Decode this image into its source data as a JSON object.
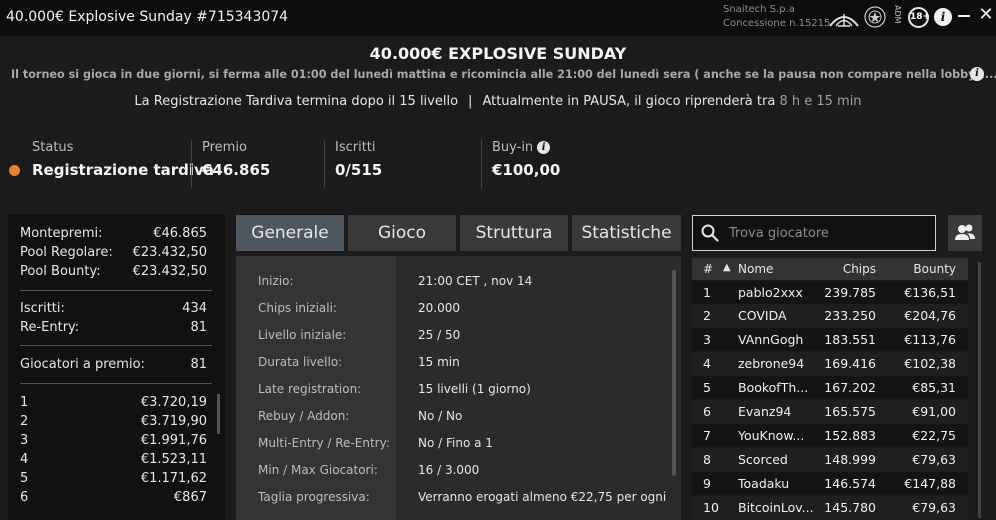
{
  "window": {
    "title": "40.000€ Explosive Sunday #715343074",
    "company_line1": "Snaitech S.p.a",
    "company_line2": "Concessione n.15215",
    "adm_label": "ADM",
    "adm_vertical": "ADM",
    "age_badge": "18+",
    "info_glyph": "i",
    "close_glyph": "✕"
  },
  "header": {
    "title": "40.000€ EXPLOSIVE SUNDAY",
    "description": "Il torneo si gioca in due giorni, si ferma alle 01:00 del lunedì mattina e ricomincia alle 21:00 del lunedì sera ( anche se la pausa non compare nella lobby)....",
    "late_reg": "La Registrazione Tardiva termina dopo il 15 livello",
    "separator": "|",
    "pause_text": "Attualmente in PAUSA, il gioco riprenderà tra",
    "pause_time": "8 h e 15 min"
  },
  "status": {
    "status_label": "Status",
    "status_value": "Registrazione tardiva",
    "status_color": "#e8832a",
    "premio_label": "Premio",
    "premio_value": "€46.865",
    "iscritti_label": "Iscritti",
    "iscritti_value": "0/515",
    "buyin_label": "Buy-in",
    "buyin_value": "€100,00"
  },
  "prize_panel": {
    "montepremi_label": "Montepremi:",
    "montepremi_value": "€46.865",
    "pool_regolare_label": "Pool Regolare:",
    "pool_regolare_value": "€23.432,50",
    "pool_bounty_label": "Pool Bounty:",
    "pool_bounty_value": "€23.432,50",
    "iscritti_label": "Iscritti:",
    "iscritti_value": "434",
    "reentry_label": "Re-Entry:",
    "reentry_value": "81",
    "giocatori_label": "Giocatori a premio:",
    "giocatori_value": "81",
    "payouts": [
      {
        "pos": "1",
        "amount": "€3.720,19"
      },
      {
        "pos": "2",
        "amount": "€3.719,90"
      },
      {
        "pos": "3",
        "amount": "€1.991,76"
      },
      {
        "pos": "4",
        "amount": "€1.523,11"
      },
      {
        "pos": "5",
        "amount": "€1.171,62"
      },
      {
        "pos": "6",
        "amount": "€867"
      }
    ]
  },
  "tabs": [
    {
      "label": "Generale",
      "active": true
    },
    {
      "label": "Gioco",
      "active": false
    },
    {
      "label": "Struttura",
      "active": false
    },
    {
      "label": "Statistiche",
      "active": false
    }
  ],
  "general_info": [
    {
      "key": "Inizio:",
      "value": "21:00 CET , nov 14"
    },
    {
      "key": "Chips iniziali:",
      "value": "20.000"
    },
    {
      "key": "Livello iniziale:",
      "value": "25 / 50"
    },
    {
      "key": "Durata livello:",
      "value": "15 min"
    },
    {
      "key": "Late registration:",
      "value": "15 livelli (1 giorno)"
    },
    {
      "key": "Rebuy / Addon:",
      "value": "No / No"
    },
    {
      "key": "Multi-Entry / Re-Entry:",
      "value": "No / Fino a 1"
    },
    {
      "key": "Min / Max Giocatori:",
      "value": "16 / 3.000"
    },
    {
      "key": "Taglia progressiva:",
      "value": "Verranno erogati almeno €22,75 per ogni"
    }
  ],
  "search": {
    "placeholder": "Trova giocatore"
  },
  "players": {
    "headers": {
      "num": "#",
      "sort": "▲",
      "name": "Nome",
      "chips": "Chips",
      "bounty": "Bounty"
    },
    "rows": [
      {
        "num": "1",
        "name": "pablo2xxx",
        "chips": "239.785",
        "bounty": "€136,51"
      },
      {
        "num": "2",
        "name": "COVIDA",
        "chips": "233.250",
        "bounty": "€204,76"
      },
      {
        "num": "3",
        "name": "VAnnGogh",
        "chips": "183.551",
        "bounty": "€113,76"
      },
      {
        "num": "4",
        "name": "zebrone94",
        "chips": "169.416",
        "bounty": "€102,38"
      },
      {
        "num": "5",
        "name": "BookofTh...",
        "chips": "167.202",
        "bounty": "€85,31"
      },
      {
        "num": "6",
        "name": "Evanz94",
        "chips": "165.575",
        "bounty": "€91,00"
      },
      {
        "num": "7",
        "name": "YouKnow...",
        "chips": "152.883",
        "bounty": "€22,75"
      },
      {
        "num": "8",
        "name": "Scorced",
        "chips": "148.999",
        "bounty": "€79,63"
      },
      {
        "num": "9",
        "name": "Toadaku",
        "chips": "146.574",
        "bounty": "€147,88"
      },
      {
        "num": "10",
        "name": "BitcoinLov...",
        "chips": "145.780",
        "bounty": "€79,63"
      }
    ]
  }
}
